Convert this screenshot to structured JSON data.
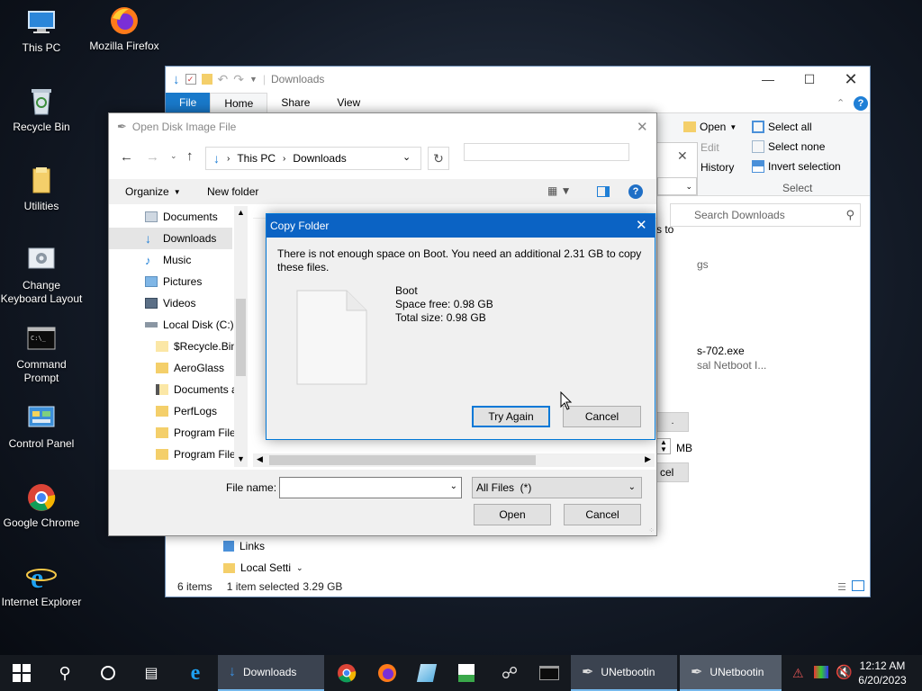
{
  "desktop": {
    "icons": [
      {
        "label": "This PC"
      },
      {
        "label": "Mozilla Firefox"
      },
      {
        "label": "Recycle Bin"
      },
      {
        "label": "Utilities"
      },
      {
        "label": "Change Keyboard Layout"
      },
      {
        "label": "Command Prompt"
      },
      {
        "label": "Control Panel"
      },
      {
        "label": "Google Chrome"
      },
      {
        "label": "Internet Explorer"
      }
    ]
  },
  "explorer": {
    "title": "Downloads",
    "tabs": {
      "file": "File",
      "home": "Home",
      "share": "Share",
      "view": "View"
    },
    "ribbon": {
      "open": "Open",
      "edit": "Edit",
      "history": "History",
      "select_all": "Select all",
      "select_none": "Select none",
      "invert_selection": "Invert selection",
      "select_group": "Select"
    },
    "search_placeholder": "Search Downloads",
    "fragments": {
      "to": "s to",
      "logs": "gs",
      "exe": "s-702.exe",
      "netboot": "sal Netboot I...",
      "mb": "MB",
      "cel": "cel"
    },
    "nav": {
      "links": "Links",
      "local_settings": "Local Setti"
    },
    "status": {
      "items": "6 items",
      "selected": "1 item selected",
      "size": "3.29 GB"
    }
  },
  "open_dialog": {
    "title": "Open Disk Image File",
    "breadcrumb": {
      "this_pc": "This PC",
      "downloads": "Downloads"
    },
    "toolbar": {
      "organize": "Organize",
      "new_folder": "New folder"
    },
    "nav_items": [
      {
        "label": "Documents"
      },
      {
        "label": "Downloads"
      },
      {
        "label": "Music"
      },
      {
        "label": "Pictures"
      },
      {
        "label": "Videos"
      },
      {
        "label": "Local Disk (C:)"
      },
      {
        "label": "$Recycle.Bin"
      },
      {
        "label": "AeroGlass"
      },
      {
        "label": "Documents a"
      },
      {
        "label": "PerfLogs"
      },
      {
        "label": "Program Files"
      },
      {
        "label": "Program Files"
      }
    ],
    "file_name_label": "File name:",
    "file_name_value": "",
    "file_type": "All Files  (*)",
    "open_button": "Open",
    "cancel_button": "Cancel"
  },
  "copy_dialog": {
    "title": "Copy Folder",
    "message": "There is not enough space on Boot. You need an additional 2.31 GB to copy these files.",
    "drive_name": "Boot",
    "space_free": "Space free: 0.98 GB",
    "total_size": "Total size: 0.98 GB",
    "try_again": "Try Again",
    "cancel": "Cancel"
  },
  "taskbar": {
    "downloads": "Downloads",
    "unetbootin_1": "UNetbootin",
    "unetbootin_2": "UNetbootin",
    "time": "12:12 AM",
    "date": "6/20/2023"
  }
}
